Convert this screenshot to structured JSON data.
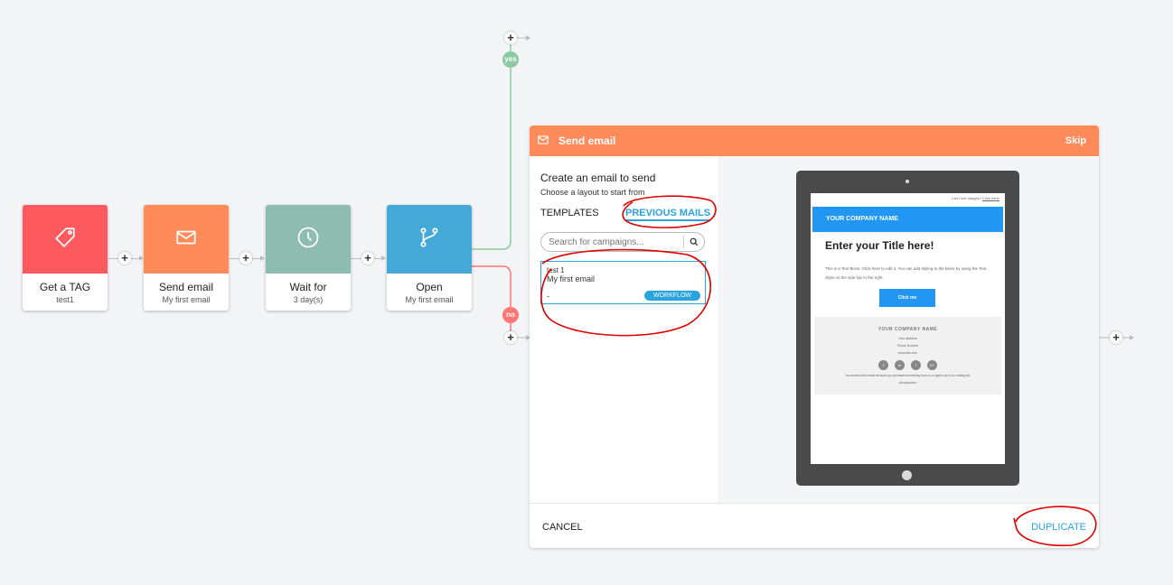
{
  "colors": {
    "red": "#fd5a5f",
    "orange": "#ff8a5a",
    "teal": "#8fbcb0",
    "blue": "#44a9d6",
    "yes_green": "#8bc9a2",
    "no_red": "#ff7676",
    "link_blue": "#2aa3e0",
    "annotation": "#dd0000"
  },
  "workflow": {
    "nodes": [
      {
        "title": "Get a TAG",
        "subtitle": "test1",
        "icon": "tag-icon"
      },
      {
        "title": "Send email",
        "subtitle": "My first email",
        "icon": "envelope-icon"
      },
      {
        "title": "Wait for",
        "subtitle": "3 day(s)",
        "icon": "clock-icon"
      },
      {
        "title": "Open",
        "subtitle": "My first email",
        "icon": "branch-icon"
      }
    ],
    "plus": "+",
    "yes_label": "yes",
    "no_label": "no"
  },
  "panel": {
    "title": "Send email",
    "skip": "Skip",
    "heading": "Create an email to send",
    "subheading": "Choose a layout to start from",
    "tabs": {
      "templates": "TEMPLATES",
      "previous": "PREVIOUS MAILS"
    },
    "search": {
      "placeholder": "Search for campaigns..."
    },
    "card": {
      "name": "test 1",
      "subject": "My first email",
      "meta": "-",
      "tag": "WORKFLOW"
    },
    "footer": {
      "cancel": "CANCEL",
      "duplicate": "DUPLICATE"
    }
  },
  "preview": {
    "topline": "Can't see images?",
    "topline_link": "Click here!",
    "company": "YOUR COMPANY NAME",
    "title": "Enter your Title here!",
    "body": "This is a Text Block. Click here to edit it. You can add styling to the block by using the Text Style on the side bar to the right.",
    "button": "Click me",
    "footer_company": "YOUR COMPANY NAME",
    "address": "Your address",
    "phone": "Phone Number",
    "website": "www.site.com",
    "social": [
      "f",
      "in",
      "t",
      "G+"
    ],
    "disclaimer": "You received this email because you purchased something from us or signed up to our mailing list.",
    "unsubscribe": "Unsubscribe"
  }
}
